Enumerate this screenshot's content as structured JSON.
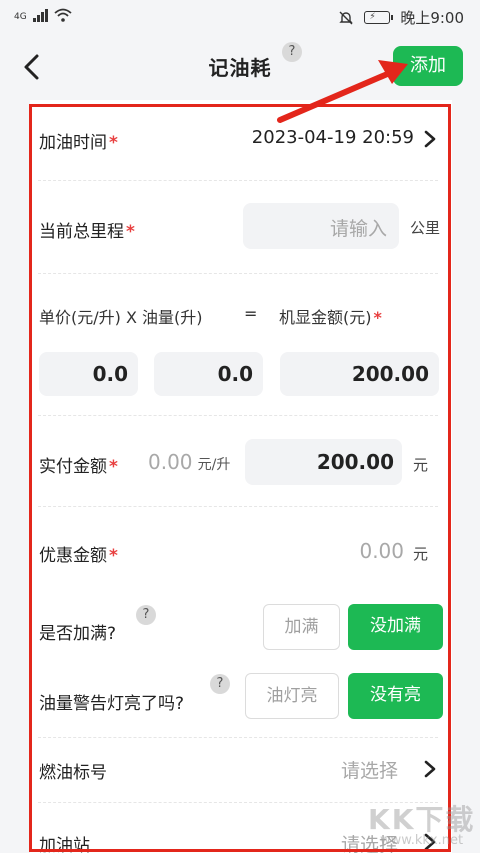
{
  "status_bar": {
    "network": "4G",
    "time": "晚上9:00"
  },
  "nav": {
    "title": "记油耗",
    "help": "?",
    "add_label": "添加"
  },
  "form": {
    "refuel_time": {
      "label": "加油时间",
      "value": "2023-04-19 20:59"
    },
    "odometer": {
      "label": "当前总里程",
      "placeholder": "请输入",
      "unit": "公里"
    },
    "price_header": {
      "unit_price": "单价(元/升)",
      "times": "X",
      "volume": "油量(升)",
      "equals": "=",
      "machine_amount": "机显金额(元)"
    },
    "price_values": {
      "unit_price": "0.0",
      "volume": "0.0",
      "machine_amount": "200.00"
    },
    "paid": {
      "label": "实付金额",
      "per_liter_value": "0.00",
      "per_liter_unit": "元/升",
      "amount": "200.00",
      "unit": "元"
    },
    "discount": {
      "label": "优惠金额",
      "value": "0.00",
      "unit": "元"
    },
    "full_tank": {
      "label": "是否加满?",
      "help": "?",
      "option_yes": "加满",
      "option_no": "没加满",
      "selected": "没加满"
    },
    "warning_light": {
      "label": "油量警告灯亮了吗?",
      "help": "?",
      "option_yes": "油灯亮",
      "option_no": "没有亮",
      "selected": "没有亮"
    },
    "fuel_grade": {
      "label": "燃油标号",
      "placeholder": "请选择"
    },
    "station": {
      "label": "加油站",
      "placeholder": "请选择"
    }
  },
  "watermark": {
    "main": "KK下载",
    "sub": "www.kkx.net"
  },
  "colors": {
    "accent_green": "#1db954",
    "required_star": "#e84040",
    "annotation_red": "#e3261b"
  }
}
